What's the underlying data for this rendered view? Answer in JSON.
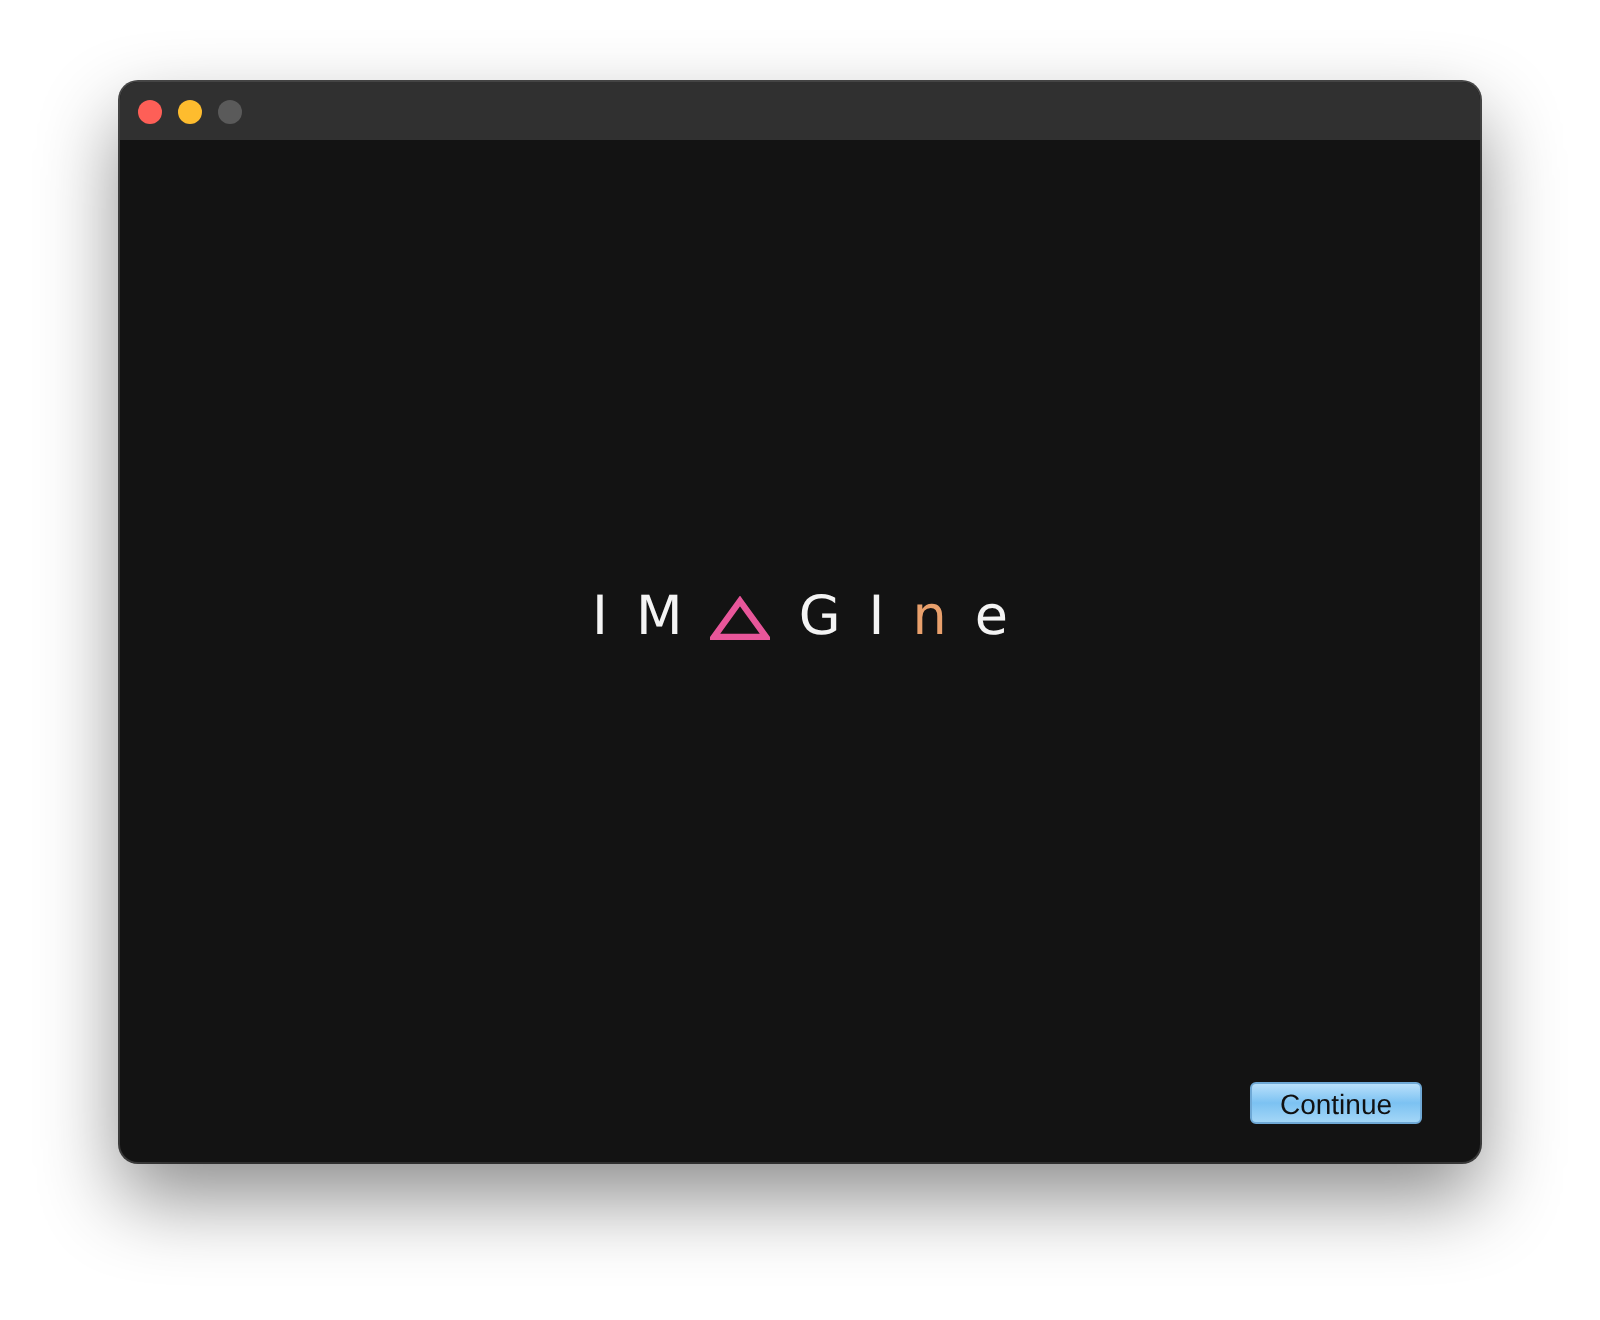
{
  "logo": {
    "parts": [
      {
        "kind": "letters",
        "text": "IM"
      },
      {
        "kind": "triangle",
        "color": "#e8569a"
      },
      {
        "kind": "letters",
        "text": "GI"
      },
      {
        "kind": "letters",
        "text": "n",
        "color": "#e9a06c"
      },
      {
        "kind": "letters",
        "text": "e"
      }
    ]
  },
  "button": {
    "label": "Continue"
  }
}
